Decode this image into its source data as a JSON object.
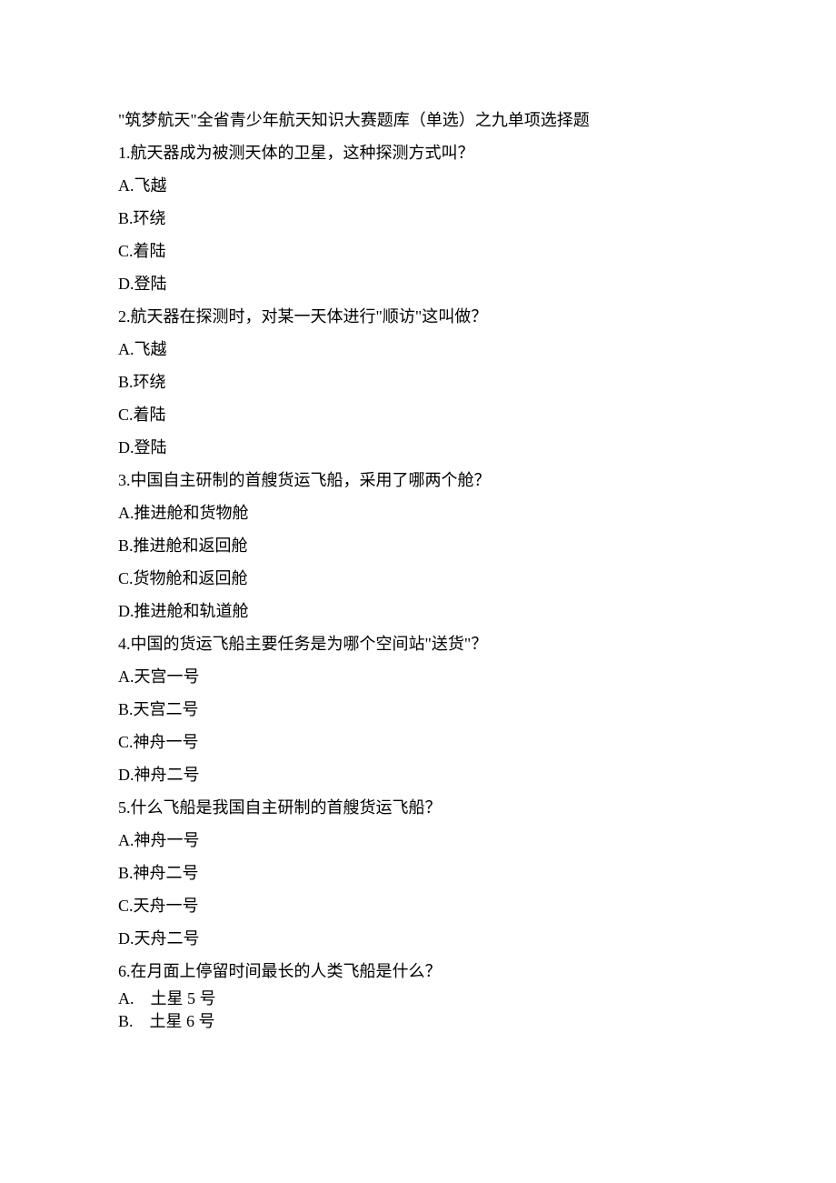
{
  "title": "\"筑梦航天\"全省青少年航天知识大赛题库（单选）之九单项选择题",
  "questions": [
    {
      "stem": "1.航天器成为被测天体的卫星，这种探测方式叫？",
      "options": [
        "A.飞越",
        "B.环绕",
        "C.着陆",
        "D.登陆"
      ]
    },
    {
      "stem": "2.航天器在探测时，对某一天体进行\"顺访\"这叫做？",
      "options": [
        "A.飞越",
        "B.环绕",
        "C.着陆",
        "D.登陆"
      ]
    },
    {
      "stem": "3.中国自主研制的首艘货运飞船，采用了哪两个舱？",
      "options": [
        "A.推进舱和货物舱",
        "B.推进舱和返回舱",
        "C.货物舱和返回舱",
        "D.推进舱和轨道舱"
      ]
    },
    {
      "stem": "4.中国的货运飞船主要任务是为哪个空间站\"送货\"？",
      "options": [
        "A.天宫一号",
        "B.天宫二号",
        "C.神舟一号",
        "D.神舟二号"
      ]
    },
    {
      "stem": "5.什么飞船是我国自主研制的首艘货运飞船？",
      "options": [
        "A.神舟一号",
        "B.神舟二号",
        "C.天舟一号",
        "D.天舟二号"
      ]
    },
    {
      "stem": "6.在月面上停留时间最长的人类飞船是什么？",
      "options": [
        "A.　土星 5 号",
        "B.　土星 6 号"
      ]
    }
  ]
}
